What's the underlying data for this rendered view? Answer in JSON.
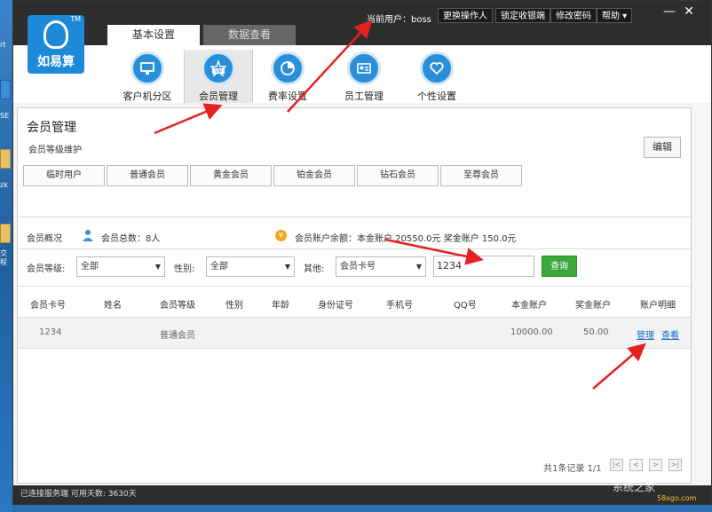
{
  "desktop": {
    "labels": [
      "rt",
      "SE",
      "zk",
      "交",
      "程"
    ]
  },
  "logo": {
    "text": "如易算",
    "tm": "TM"
  },
  "main_tabs": [
    {
      "label": "基本设置"
    },
    {
      "label": "数据查看"
    }
  ],
  "header": {
    "current_user": "当前用户：boss",
    "buttons": [
      "更换操作人",
      "锁定收银端",
      "修改密码",
      "帮助 ▾"
    ]
  },
  "window_controls": [
    "—",
    "✕"
  ],
  "nav": [
    {
      "label": "客户机分区",
      "icon": "monitor-icon"
    },
    {
      "label": "会员管理",
      "icon": "vip-star-icon"
    },
    {
      "label": "费率设置",
      "icon": "pie-chart-icon"
    },
    {
      "label": "员工管理",
      "icon": "id-card-icon"
    },
    {
      "label": "个性设置",
      "icon": "heart-icon"
    }
  ],
  "panel": {
    "title": "会员管理",
    "subtitle": "会员等级维护",
    "edit_label": "编辑",
    "levels": [
      "临时用户",
      "普通会员",
      "黄金会员",
      "铂金会员",
      "钻石会员",
      "至尊会员"
    ]
  },
  "overview": {
    "label": "会员概况",
    "total": "会员总数：8人",
    "balance": "会员账户余额：本金账户 20550.0元    奖金账户 150.0元"
  },
  "filters": {
    "level_label": "会员等级:",
    "level_value": "全部",
    "gender_label": "性别:",
    "gender_value": "全部",
    "other_label": "其他:",
    "other_value": "会员卡号",
    "search_value": "1234",
    "query_label": "查询"
  },
  "table": {
    "headers": [
      "会员卡号",
      "姓名",
      "会员等级",
      "性别",
      "年龄",
      "身份证号",
      "手机号",
      "QQ号",
      "本金账户",
      "奖金账户",
      "账户明细"
    ],
    "rows": [
      {
        "card": "1234",
        "name": "",
        "level": "普通会员",
        "gender": "",
        "age": "",
        "id": "",
        "phone": "",
        "qq": "",
        "principal": "10000.00",
        "bonus": "50.00",
        "manage": "管理",
        "view": "查看"
      }
    ]
  },
  "pager": {
    "summary": "共1条记录 1/1",
    "buttons": [
      "|<",
      "<",
      ">",
      ">|"
    ]
  },
  "status": {
    "text": "已连接服务端    可用天数: 3630天"
  },
  "watermark": {
    "text": "系统之家",
    "sub": "58xgo.com"
  },
  "colors": {
    "accent": "#1c8ad8",
    "query": "#3aa93a",
    "link": "#1a6fc4",
    "arrow": "#e52222"
  }
}
